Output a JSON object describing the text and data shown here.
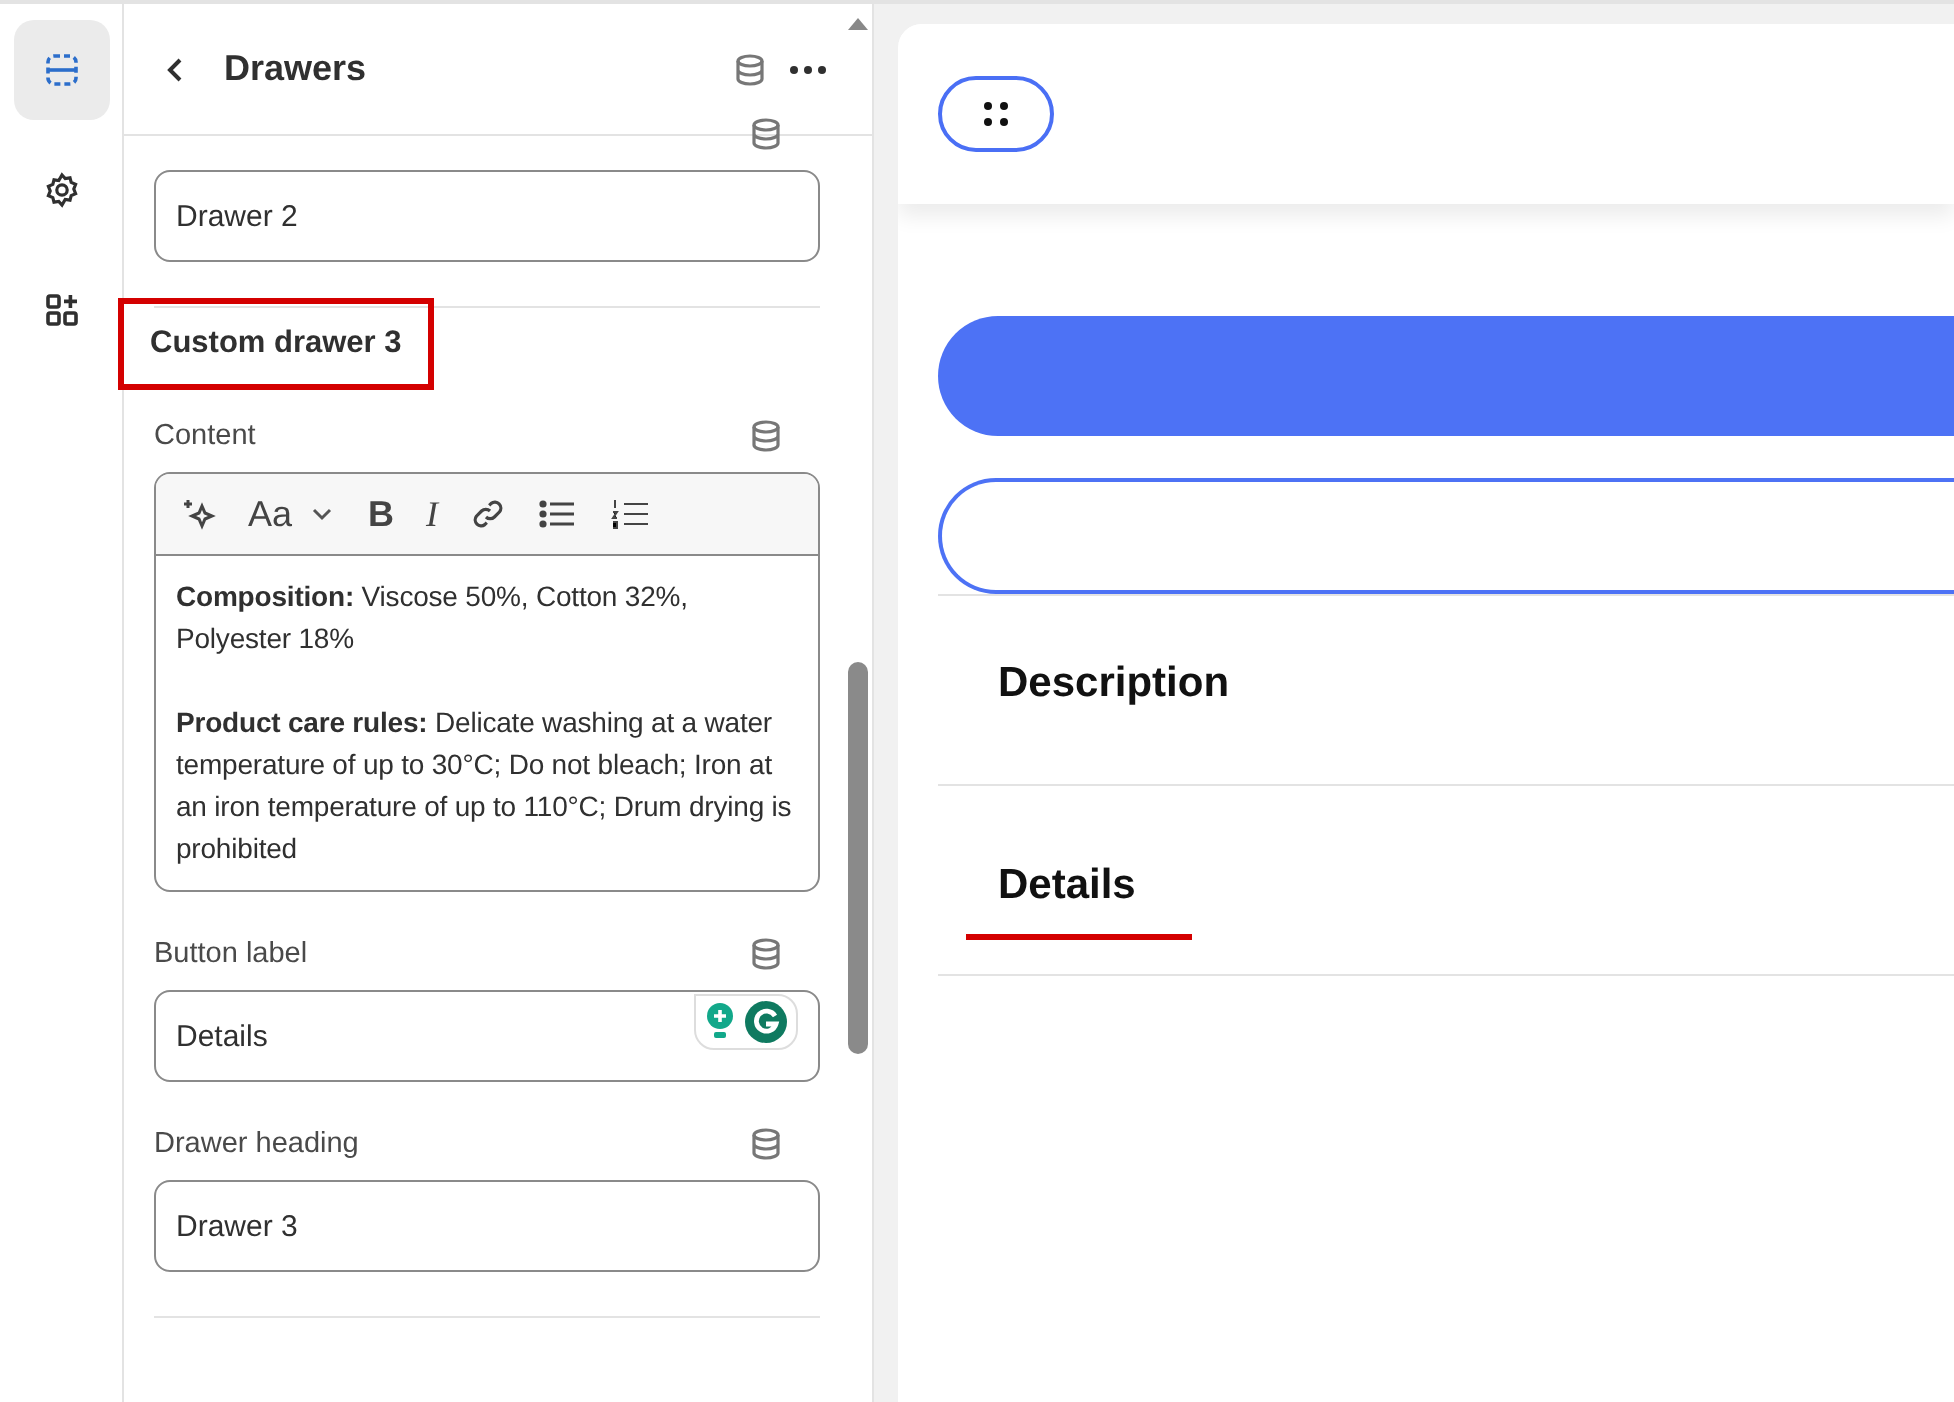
{
  "rail": [
    {
      "kind": "sections",
      "selected": true
    },
    {
      "kind": "settings",
      "selected": false
    },
    {
      "kind": "apps",
      "selected": false
    }
  ],
  "panel": {
    "title": "Drawers",
    "items": [
      {
        "kind": "field",
        "value": "Drawer 2"
      },
      {
        "kind": "heading",
        "text": "Custom drawer 3",
        "highlighted": true
      },
      {
        "kind": "richtext",
        "label": "Content",
        "toolbar": [
          {
            "kind": "ai"
          },
          {
            "kind": "font",
            "label": "Aa"
          },
          {
            "kind": "bold",
            "label": "B"
          },
          {
            "kind": "italic",
            "label": "I"
          },
          {
            "kind": "link"
          },
          {
            "kind": "bullets"
          },
          {
            "kind": "numbers"
          }
        ],
        "paragraphs": [
          "**Composition:** Viscose 50%, Cotton 32%, Polyester 18%",
          "**Product care rules:** Delicate washing at a water temperature of up to 30°C; Do not bleach; Iron at an iron temperature of up to 110°C; Drum drying is prohibited"
        ]
      },
      {
        "kind": "field",
        "label": "Button label",
        "value": "Details",
        "assistant": true
      },
      {
        "kind": "field",
        "label": "Drawer heading",
        "value": "Drawer 3"
      }
    ]
  },
  "preview": {
    "drawers": [
      {
        "title": "Description",
        "highlighted": false
      },
      {
        "title": "Details",
        "highlighted": true
      }
    ]
  }
}
